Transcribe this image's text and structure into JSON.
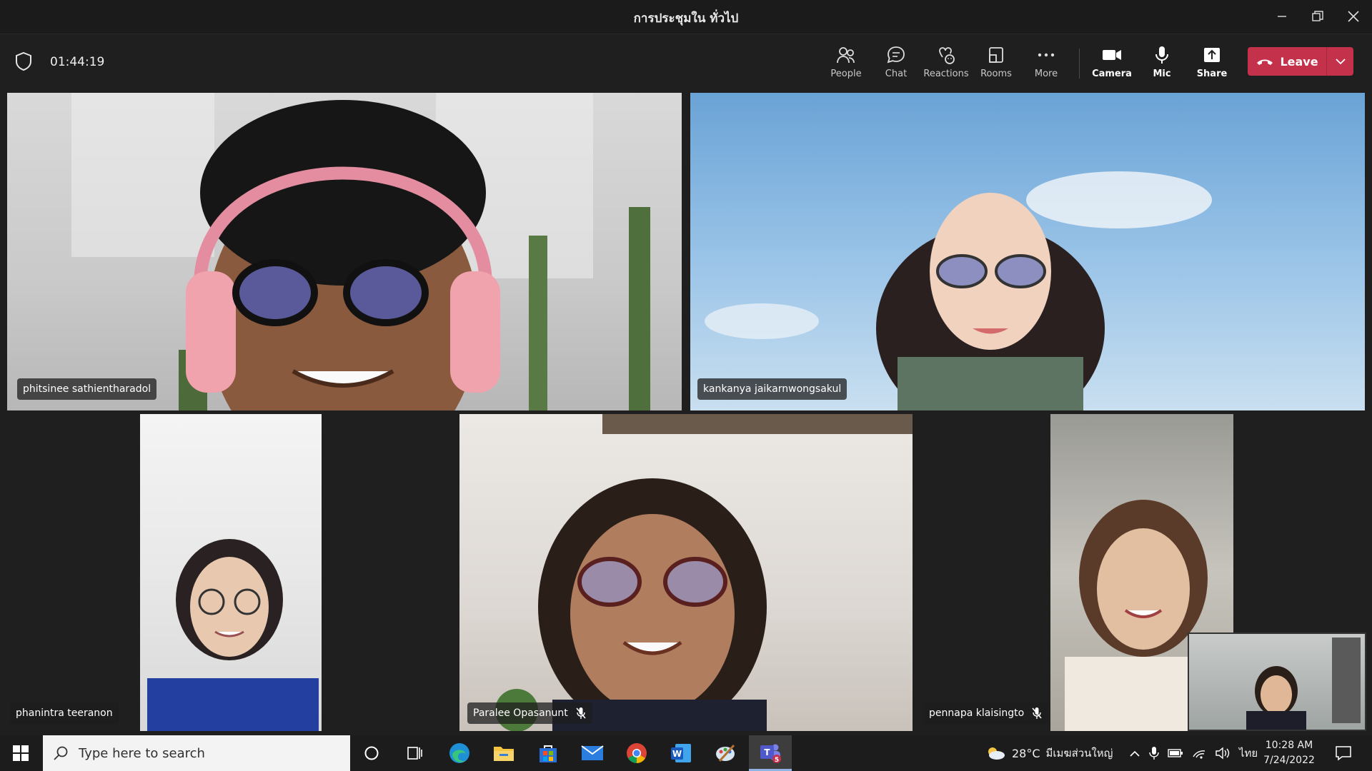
{
  "window": {
    "title": "การประชุมใน ทั่วไป"
  },
  "toolbar": {
    "timer": "01:44:19",
    "items": [
      {
        "label": "People",
        "icon": "people-icon"
      },
      {
        "label": "Chat",
        "icon": "chat-icon"
      },
      {
        "label": "Reactions",
        "icon": "reactions-icon"
      },
      {
        "label": "Rooms",
        "icon": "rooms-icon"
      },
      {
        "label": "More",
        "icon": "more-icon"
      },
      {
        "label": "Camera",
        "icon": "camera-icon"
      },
      {
        "label": "Mic",
        "icon": "mic-icon"
      },
      {
        "label": "Share",
        "icon": "share-icon"
      }
    ],
    "leave_label": "Leave",
    "leave_color": "#c4314b"
  },
  "participants": [
    {
      "name": "phitsinee sathientharadol",
      "muted": false
    },
    {
      "name": "kankanya jaikarnwongsakul",
      "muted": false
    },
    {
      "name": "phanintra teeranon",
      "muted": false
    },
    {
      "name": "Paralee Opasanunt",
      "muted": true
    },
    {
      "name": "pennapa klaisingto",
      "muted": true
    }
  ],
  "taskbar": {
    "search_placeholder": "Type here to search",
    "apps": [
      "cortana-icon",
      "task-view-icon",
      "edge-icon",
      "file-explorer-icon",
      "store-icon",
      "mail-icon",
      "chrome-icon",
      "word-icon",
      "paint-icon",
      "teams-icon"
    ],
    "teams_badge": "5",
    "weather_temp": "28°C",
    "weather_text": "มีเมฆส่วนใหญ่",
    "language": "ไทย",
    "time": "10:28 AM",
    "date": "7/24/2022"
  }
}
